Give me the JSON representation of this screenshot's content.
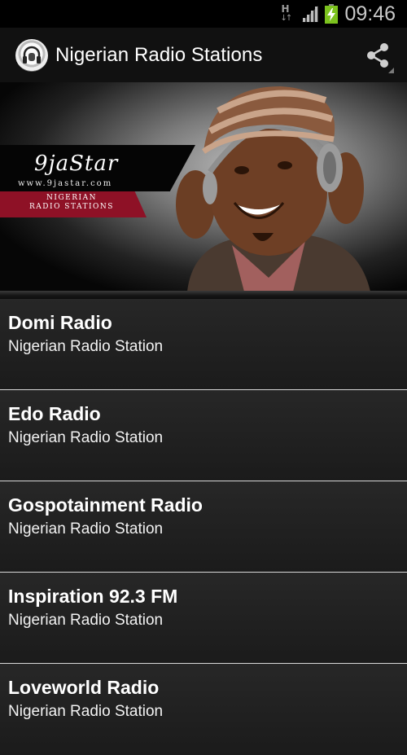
{
  "status_bar": {
    "network_type": "H",
    "time": "09:46",
    "icons": [
      "network-type-icon",
      "signal-icon",
      "battery-charging-icon"
    ]
  },
  "action_bar": {
    "title": "Nigerian Radio Stations",
    "icons": [
      "app-logo-icon",
      "share-icon"
    ]
  },
  "banner": {
    "logo_text": "9jaStar",
    "logo_url": "www.9jastar.com",
    "tagline_line1": "NIGERIAN",
    "tagline_line2": "RADIO STATIONS"
  },
  "stations": [
    {
      "name": "Domi Radio",
      "subtitle": "Nigerian Radio Station"
    },
    {
      "name": "Edo Radio",
      "subtitle": "Nigerian Radio Station"
    },
    {
      "name": "Gospotainment Radio",
      "subtitle": "Nigerian Radio Station"
    },
    {
      "name": "Inspiration 92.3 FM",
      "subtitle": "Nigerian Radio Station"
    },
    {
      "name": "Loveworld Radio",
      "subtitle": "Nigerian Radio Station"
    }
  ],
  "colors": {
    "banner_red": "#8e1126",
    "battery_green": "#7cc21e",
    "background": "#1d1d1d"
  }
}
